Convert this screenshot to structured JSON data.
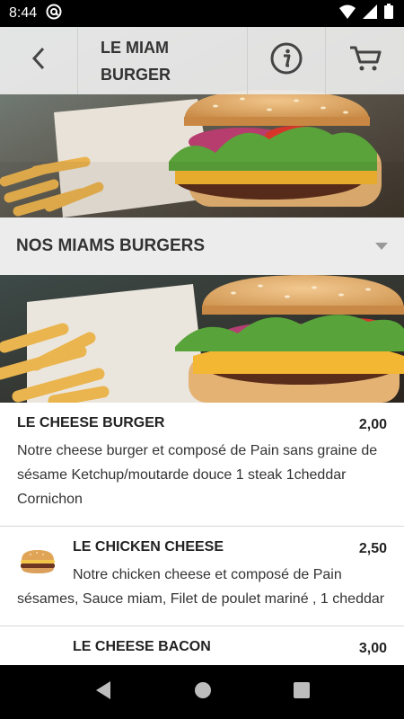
{
  "status_bar": {
    "time": "8:44",
    "icons": [
      "at-sign-icon",
      "wifi-icon",
      "cellular-signal-icon",
      "battery-icon"
    ]
  },
  "toolbar": {
    "title": "LE MIAM BURGER",
    "back_icon": "chevron-left-icon",
    "info_icon": "info-icon",
    "cart_icon": "cart-icon"
  },
  "category": {
    "title": "NOS MIAMS BURGERS",
    "icon": "caret-down-icon"
  },
  "items": [
    {
      "name": "LE CHEESE BURGER",
      "price": "2,00",
      "description": "Notre cheese burger et composé de Pain sans graine de sésame Ketchup/moutarde douce 1 steak 1cheddar Cornichon"
    },
    {
      "name": "LE CHICKEN CHEESE",
      "price": "2,50",
      "description": "Notre chicken cheese et composé de Pain sésames, Sauce miam, Filet de poulet mariné , 1 cheddar"
    },
    {
      "name": "LE CHEESE BACON",
      "price": "3,00",
      "description": ""
    }
  ],
  "nav_bar": {
    "icons": [
      "back-triangle-icon",
      "home-circle-icon",
      "recents-square-icon"
    ]
  }
}
